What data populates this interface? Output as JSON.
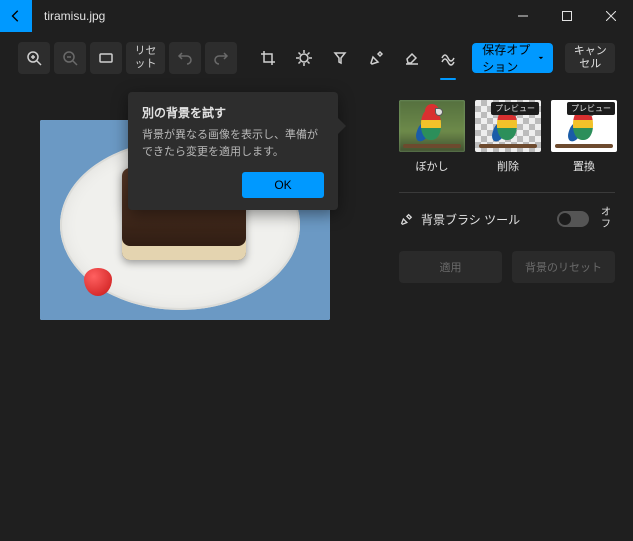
{
  "titlebar": {
    "filename": "tiramisu.jpg"
  },
  "toolbar": {
    "reset_label": "リセット",
    "save_label": "保存オプション",
    "cancel_label": "キャンセル"
  },
  "tooltip": {
    "title": "別の背景を試す",
    "body": "背景が異なる画像を表示し、準備ができたら変更を適用します。",
    "ok": "OK"
  },
  "panel": {
    "thumbs": [
      {
        "label": "ぼかし",
        "badge": null
      },
      {
        "label": "削除",
        "badge": "プレビュー"
      },
      {
        "label": "置換",
        "badge": "プレビュー"
      }
    ],
    "brush_label": "背景ブラシ ツール",
    "toggle_state": "オフ",
    "apply": "適用",
    "reset_bg": "背景のリセット"
  }
}
